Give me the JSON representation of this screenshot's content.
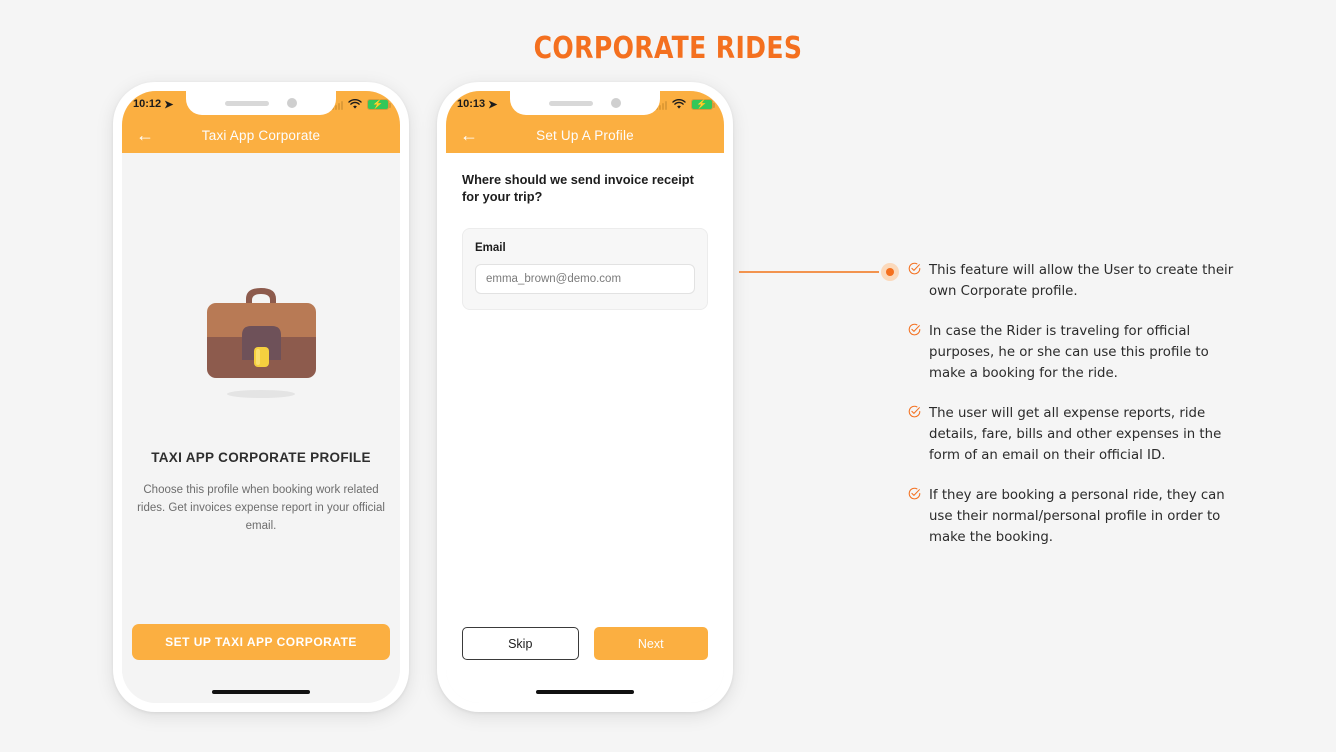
{
  "page": {
    "title": "CORPORATE RIDES",
    "accent_color": "#f4701f",
    "header_color": "#fbaf41",
    "background": "#f5f5f5"
  },
  "phone_one": {
    "status": {
      "time": "10:12",
      "location_icon": "location-arrow-icon",
      "signal_icon": "signal-bars-icon",
      "wifi_icon": "wifi-icon",
      "battery_icon": "battery-charging-icon"
    },
    "appbar": {
      "back_icon": "back-arrow-icon",
      "title": "Taxi App Corporate"
    },
    "illustration": {
      "icon": "briefcase-icon",
      "body_color": "#b87a55",
      "base_color": "#8d5b4d",
      "clasp_color": "#6e5159",
      "lock_color": "#f5d03f",
      "handle_color": "#8d5b4d"
    },
    "promo": {
      "title": "TAXI APP CORPORATE PROFILE",
      "description": "Choose this profile when booking work related rides. Get invoices expense report in your official email."
    },
    "cta_label": "SET UP TAXI APP CORPORATE"
  },
  "phone_two": {
    "status": {
      "time": "10:13",
      "location_icon": "location-arrow-icon",
      "signal_icon": "signal-bars-icon",
      "wifi_icon": "wifi-icon",
      "battery_icon": "battery-charging-icon"
    },
    "appbar": {
      "back_icon": "back-arrow-icon",
      "title": "Set Up A Profile"
    },
    "question": "Where should we send invoice receipt for your trip?",
    "email_field": {
      "label": "Email",
      "value": "emma_brown@demo.com",
      "placeholder": "emma_brown@demo.com"
    },
    "buttons": {
      "skip_label": "Skip",
      "next_label": "Next"
    }
  },
  "annotations": {
    "marker_icon": "connector-dot-icon",
    "bullet_icon": "check-circle-icon",
    "items": [
      "This feature will allow the User to create their own Corporate profile.",
      "In case the Rider is traveling for official purposes, he or she can use this profile to make a booking for the ride.",
      "The user will get all expense reports, ride details, fare, bills and other expenses in the form of an email on their official ID.",
      "If they are booking a personal ride, they can use their normal/personal profile in order to make the booking."
    ]
  }
}
